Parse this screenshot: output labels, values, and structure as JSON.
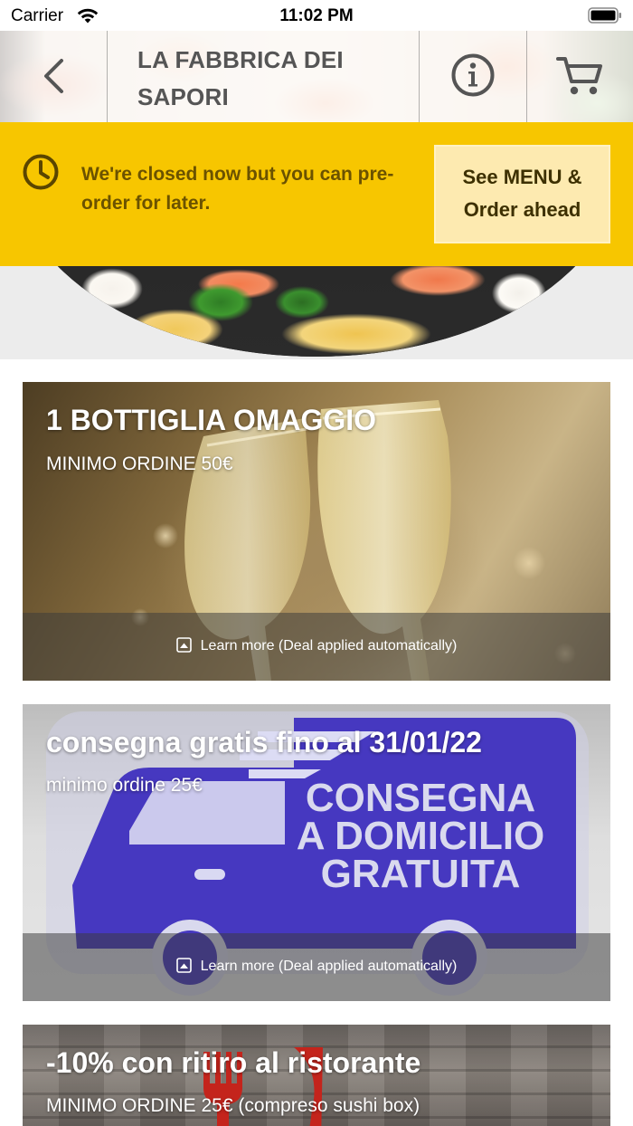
{
  "status_bar": {
    "carrier": "Carrier",
    "time": "11:02 PM"
  },
  "header": {
    "title": "LA FABBRICA DEI SAPORI",
    "back_icon": "chevron-left-icon",
    "info_icon": "info-circle-icon",
    "cart_icon": "cart-icon"
  },
  "banner": {
    "message": "We're closed now but you can pre-order for later.",
    "button_label": "See MENU & Order ahead",
    "background_color": "#f7c600",
    "icon": "clock-icon"
  },
  "deals": [
    {
      "title": "1 BOTTIGLIA OMAGGIO",
      "subtitle": "MINIMO ORDINE 50€",
      "learn_more": "Learn more (Deal applied automatically)"
    },
    {
      "title": "consegna gratis fino al 31/01/22",
      "subtitle": "minimo ordine 25€",
      "learn_more": "Learn more (Deal applied automatically)",
      "image_text": [
        "CONSEGNA",
        "A DOMICILIO",
        "GRATUITA"
      ]
    },
    {
      "title": "-10% con ritiro al ristorante",
      "subtitle": "MINIMO ORDINE 25€ (compreso sushi box)"
    }
  ]
}
